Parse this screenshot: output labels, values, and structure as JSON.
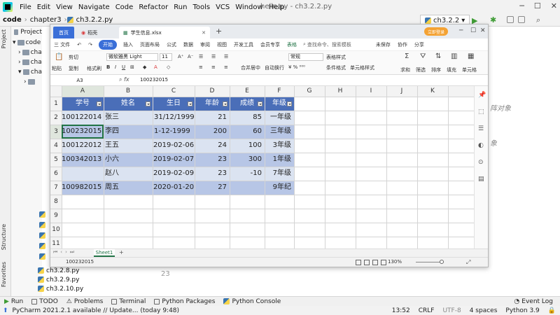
{
  "pycharm": {
    "menu": [
      "File",
      "Edit",
      "View",
      "Navigate",
      "Code",
      "Refactor",
      "Run",
      "Tools",
      "VCS",
      "Window",
      "Help"
    ],
    "window_title": "hello.py - ch3.2.2.py",
    "breadcrumb": [
      "code",
      "chapter3",
      "ch3.2.2.py"
    ],
    "run_config": "ch3.2.2",
    "left_tabs": [
      "Project",
      "Structure",
      "Favorites"
    ],
    "project_header": "Project",
    "tree": [
      {
        "label": "code",
        "indent": 0
      },
      {
        "label": "cha",
        "indent": 1
      },
      {
        "label": "cha",
        "indent": 1
      },
      {
        "label": "cha",
        "indent": 1
      },
      {
        "label": "",
        "indent": 2
      }
    ],
    "files": [
      "ch3.2.8.py",
      "ch3.2.9.py",
      "ch3.2.10.py"
    ],
    "editor_fragments": [
      "阵对象",
      "象"
    ],
    "gutter_line": "23",
    "tool_windows": [
      "Run",
      "TODO",
      "Problems",
      "Terminal",
      "Python Packages",
      "Python Console"
    ],
    "event_log": "Event Log",
    "status_message": "PyCharm 2021.2.1 available // Update... (today 9:48)",
    "status_right": [
      "13:52",
      "CRLF",
      "UTF-8",
      "4 spaces",
      "Python 3.9"
    ]
  },
  "wps": {
    "tabs": {
      "home": "首页",
      "doc": "稻壳",
      "active": "学生信息.xlsx"
    },
    "login_label": "立即登录",
    "menu": [
      "三 文件",
      "开始",
      "插入",
      "页面布局",
      "公式",
      "数据",
      "审阅",
      "视图",
      "开发工具",
      "会员专享",
      "表格"
    ],
    "search_hint": "查找命令、搜索模板",
    "menu_right": [
      "未保存",
      "协作",
      "分享"
    ],
    "ribbon": {
      "cut": "剪切",
      "paste": "粘贴",
      "copy": "复制",
      "format_painter": "格式刷",
      "font": "微软雅黑 Light",
      "font_size": "11",
      "merge": "合并居中",
      "wrap": "自动换行",
      "number_format": "常规",
      "cond_format": "条件格式",
      "cell_style": "单元格样式",
      "table_style": "表格样式",
      "sum": "求和",
      "filter": "筛选",
      "sort": "排序",
      "fill": "填充",
      "cell": "单元格"
    },
    "formula": {
      "name_box": "A3",
      "fx": "fx",
      "value": "100232015"
    },
    "columns": [
      "A",
      "B",
      "C",
      "D",
      "E",
      "F",
      "G",
      "H",
      "I",
      "J",
      "K"
    ],
    "row_numbers": [
      "1",
      "2",
      "3",
      "4",
      "5",
      "6",
      "7",
      "8",
      "9",
      "10",
      "11"
    ],
    "headers": [
      "学号",
      "姓名",
      "生日",
      "年龄",
      "成绩",
      "年级"
    ],
    "rows": [
      [
        "100122014",
        "张三",
        "31/12/1999",
        "21",
        "85",
        "一年级"
      ],
      [
        "100232015",
        "李四",
        "1-12-1999",
        "200",
        "60",
        "三年级"
      ],
      [
        "100122012",
        "王五",
        "2019-02-06",
        "24",
        "100",
        "3年级"
      ],
      [
        "100342013",
        "小六",
        "2019-02-07",
        "23",
        "300",
        "1年级"
      ],
      [
        "",
        "赵八",
        "2019-02-09",
        "23",
        "-10",
        "7年级"
      ],
      [
        "100982015",
        "周五",
        "2020-01-20",
        "27",
        "",
        "9年纪"
      ]
    ],
    "sheet_tab": "Sheet1",
    "status_text": "100232015",
    "zoom": "130%",
    "colors": {
      "header_fill": "#4a6eb8",
      "band_light": "#dbe3f1",
      "band_dark": "#b7c6e6",
      "accent": "#3a6fd8",
      "selection": "#217346"
    }
  }
}
